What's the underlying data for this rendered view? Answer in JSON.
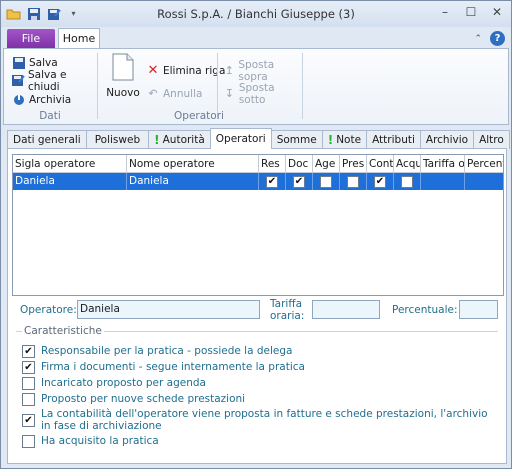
{
  "window": {
    "title": "Rossi S.p.A. / Bianchi Giuseppe (3)"
  },
  "ribbon": {
    "tabs": {
      "file": "File",
      "home": "Home"
    },
    "dati": {
      "label": "Dati",
      "salva": "Salva",
      "salva_chiudi": "Salva e chiudi",
      "archivia": "Archivia"
    },
    "operatori": {
      "label": "Operatori",
      "nuovo": "Nuovo",
      "elimina": "Elimina riga",
      "annulla": "Annulla",
      "sposta_sopra": "Sposta sopra",
      "sposta_sotto": "Sposta sotto"
    }
  },
  "tabs": [
    "Dati generali",
    "Polisweb",
    "Autorità",
    "Operatori",
    "Somme",
    "Note",
    "Attributi",
    "Archivio",
    "Altro"
  ],
  "grid": {
    "headers": [
      "Sigla operatore",
      "Nome operatore",
      "Res",
      "Doc",
      "Age",
      "Pres",
      "Cont",
      "Acqu",
      "Tariffa o",
      "Percent"
    ],
    "row": {
      "sigla": "Daniela",
      "nome": "Daniela",
      "res": true,
      "doc": true,
      "age": false,
      "pres": false,
      "cont": true,
      "acqu": false,
      "tariffa": "",
      "percent": ""
    }
  },
  "form": {
    "operatore_label": "Operatore:",
    "operatore_value": "Daniela",
    "tariffa_label_1": "Tariffa",
    "tariffa_label_2": "oraria:",
    "percentuale_label": "Percentuale:"
  },
  "caratteristiche": {
    "legend": "Caratteristiche",
    "items": [
      {
        "label": "Responsabile per la pratica - possiede la delega",
        "checked": true
      },
      {
        "label": "Firma i documenti - segue internamente la pratica",
        "checked": true
      },
      {
        "label": "Incaricato proposto per agenda",
        "checked": false
      },
      {
        "label": "Proposto per nuove schede prestazioni",
        "checked": false
      },
      {
        "label": "La contabilità dell'operatore viene proposta in fatture e schede prestazioni, l'archivio in fase di archiviazione",
        "checked": true
      },
      {
        "label": "Ha acquisito la pratica",
        "checked": false
      }
    ]
  }
}
